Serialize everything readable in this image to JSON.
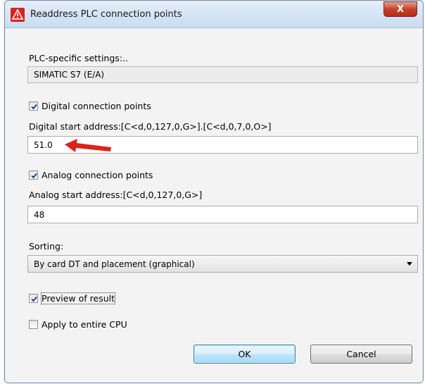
{
  "window": {
    "title": "Readdress PLC connection points",
    "close_label": "X"
  },
  "plc_settings": {
    "label": "PLC-specific settings:..",
    "value": "SIMATIC S7 (E/A)"
  },
  "digital": {
    "checkbox_label": "Digital connection points",
    "checked": true,
    "address_label": "Digital start address:[C<d,0,127,0,G>].[C<d,0,7,0,O>]",
    "address_value": "51.0"
  },
  "analog": {
    "checkbox_label": "Analog connection points",
    "checked": true,
    "address_label": "Analog start address:[C<d,0,127,0,G>]",
    "address_value": "48"
  },
  "sorting": {
    "label": "Sorting:",
    "selected": "By card DT and placement (graphical)"
  },
  "preview": {
    "label": "Preview of result",
    "checked": true
  },
  "apply_cpu": {
    "label": "Apply to entire CPU",
    "checked": false
  },
  "buttons": {
    "ok": "OK",
    "cancel": "Cancel"
  },
  "colors": {
    "annotation_arrow": "#e0201b",
    "close_button": "#c4432b"
  },
  "icons": {
    "app": "warning-triangle-icon",
    "annotation": "red-arrow-icon"
  }
}
